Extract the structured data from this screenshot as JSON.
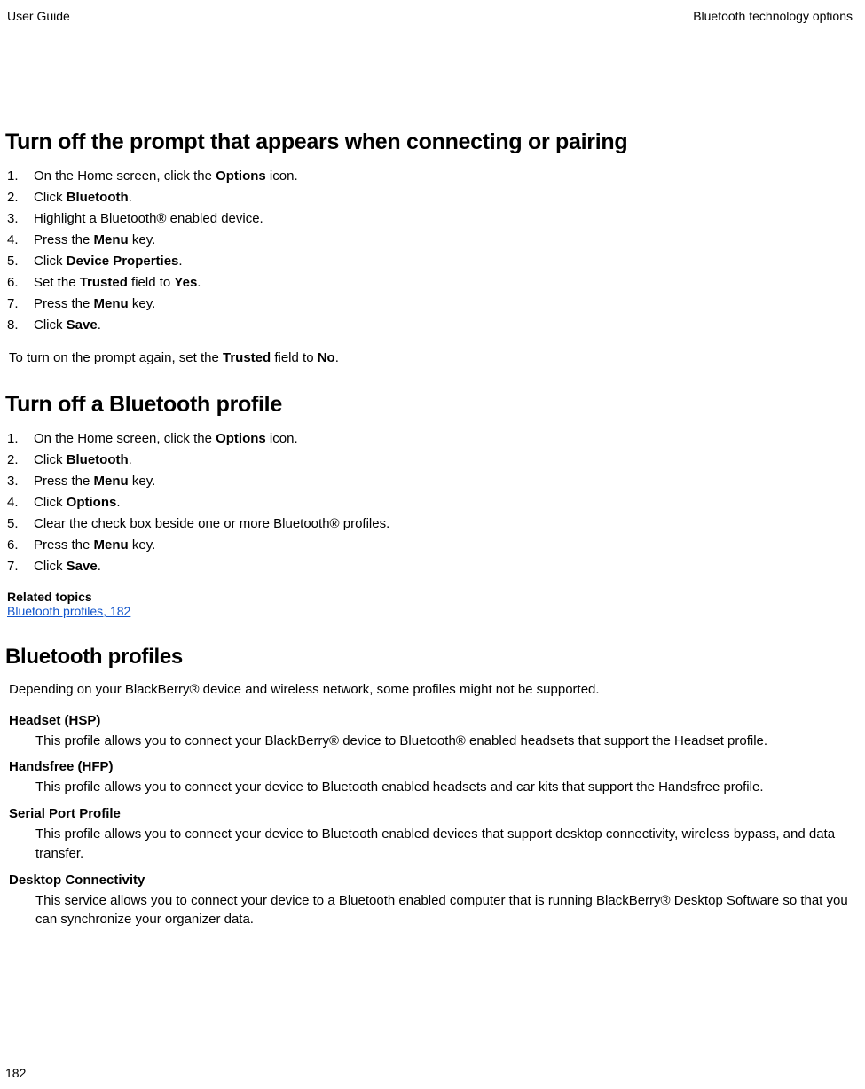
{
  "header": {
    "left": "User Guide",
    "right": "Bluetooth technology options"
  },
  "section1": {
    "title": "Turn off the prompt that appears when connecting or pairing",
    "steps": [
      [
        [
          "On the Home screen, click the "
        ],
        [
          "Options",
          true
        ],
        [
          " icon."
        ]
      ],
      [
        [
          "Click "
        ],
        [
          "Bluetooth",
          true
        ],
        [
          "."
        ]
      ],
      [
        [
          "Highlight a Bluetooth® enabled device."
        ]
      ],
      [
        [
          "Press the "
        ],
        [
          "Menu",
          true
        ],
        [
          " key."
        ]
      ],
      [
        [
          "Click "
        ],
        [
          "Device Properties",
          true
        ],
        [
          "."
        ]
      ],
      [
        [
          "Set the "
        ],
        [
          "Trusted",
          true
        ],
        [
          " field to "
        ],
        [
          "Yes",
          true
        ],
        [
          "."
        ]
      ],
      [
        [
          "Press the "
        ],
        [
          "Menu",
          true
        ],
        [
          " key."
        ]
      ],
      [
        [
          "Click "
        ],
        [
          "Save",
          true
        ],
        [
          "."
        ]
      ]
    ],
    "after": [
      [
        "To turn on the prompt again, set the "
      ],
      [
        "Trusted",
        true
      ],
      [
        " field to "
      ],
      [
        "No",
        true
      ],
      [
        "."
      ]
    ]
  },
  "section2": {
    "title": "Turn off a Bluetooth profile",
    "steps": [
      [
        [
          "On the Home screen, click the "
        ],
        [
          "Options",
          true
        ],
        [
          " icon."
        ]
      ],
      [
        [
          "Click "
        ],
        [
          "Bluetooth",
          true
        ],
        [
          "."
        ]
      ],
      [
        [
          "Press the "
        ],
        [
          "Menu",
          true
        ],
        [
          " key."
        ]
      ],
      [
        [
          "Click "
        ],
        [
          "Options",
          true
        ],
        [
          "."
        ]
      ],
      [
        [
          "Clear the check box beside one or more Bluetooth® profiles."
        ]
      ],
      [
        [
          "Press the "
        ],
        [
          "Menu",
          true
        ],
        [
          " key."
        ]
      ],
      [
        [
          "Click "
        ],
        [
          "Save",
          true
        ],
        [
          "."
        ]
      ]
    ],
    "relatedHeading": "Related topics",
    "relatedLink": "Bluetooth profiles, 182"
  },
  "section3": {
    "title": "Bluetooth profiles",
    "intro": "Depending on your BlackBerry® device and wireless network, some profiles might not be supported.",
    "items": [
      {
        "term": "Headset (HSP)",
        "desc": "This profile allows you to connect your BlackBerry® device to Bluetooth® enabled headsets that support the Headset profile."
      },
      {
        "term": "Handsfree (HFP)",
        "desc": "This profile allows you to connect your device to Bluetooth enabled headsets and car kits that support the Handsfree profile."
      },
      {
        "term": "Serial Port Profile",
        "desc": "This profile allows you to connect your device to Bluetooth enabled devices that support desktop connectivity, wireless bypass, and data transfer."
      },
      {
        "term": "Desktop Connectivity",
        "desc": "This service allows you to connect your device to a Bluetooth enabled computer that is running BlackBerry® Desktop Software so that you can synchronize your organizer data."
      }
    ]
  },
  "footer": {
    "pageNum": "182"
  }
}
